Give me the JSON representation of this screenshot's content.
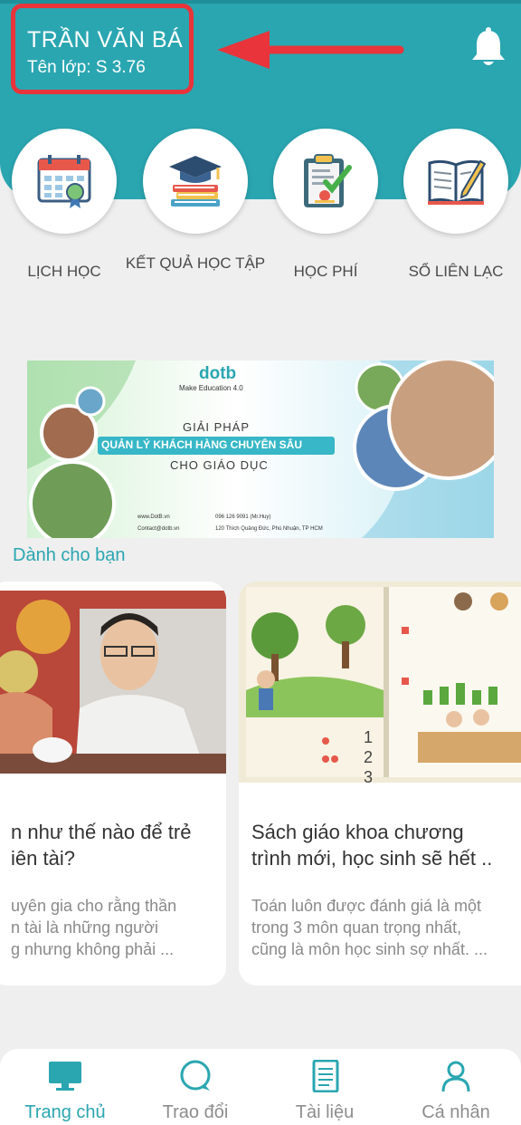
{
  "header": {
    "user_name": "TRẦN VĂN BÁ",
    "class_label": "Tên lớp: S 3.76",
    "accent_color": "#2aa6b1",
    "annotation_color": "#e8343a"
  },
  "menu": [
    {
      "label": "LỊCH HỌC",
      "icon": "calendar-icon"
    },
    {
      "label": "KẾT QUẢ HỌC TẬP",
      "icon": "graduation-books-icon"
    },
    {
      "label": "HỌC PHÍ",
      "icon": "clipboard-check-icon"
    },
    {
      "label": "SỔ LIÊN LẠC",
      "icon": "open-book-pen-icon"
    }
  ],
  "banner": {
    "brand": "dotb",
    "tagline": "Make Education 4.0",
    "line1": "GIẢI PHÁP",
    "line2": "QUẢN LÝ KHÁCH HÀNG CHUYÊN SÂU",
    "line3": "CHO GIÁO DỤC",
    "website": "www.DotB.vn",
    "email": "Contact@dotb.vn",
    "phone": "096 126 9091 (Mr.Huy)",
    "address": "120 Thích Quảng Đức, Phú Nhuận, TP HCM"
  },
  "section_title": "Dành cho bạn",
  "articles": [
    {
      "title_l1": "n như thế nào để trẻ",
      "title_l2": "iên tài?",
      "desc_l1": "uyên gia cho rằng thần",
      "desc_l2": "n tài là những người",
      "desc_l3": "g nhưng không phải ..."
    },
    {
      "title_l1": "Sách giáo khoa chương",
      "title_l2": "trình mới, học sinh sẽ hết ..",
      "desc_l1": "Toán luôn được đánh giá là một",
      "desc_l2": "trong 3 môn quan trọng nhất,",
      "desc_l3": "cũng là môn học sinh sợ nhất. ..."
    }
  ],
  "nav": [
    {
      "label": "Trang chủ",
      "icon": "monitor-icon",
      "active": true
    },
    {
      "label": "Trao đổi",
      "icon": "chat-bubble-icon",
      "active": false
    },
    {
      "label": "Tài liệu",
      "icon": "document-icon",
      "active": false
    },
    {
      "label": "Cá nhân",
      "icon": "person-icon",
      "active": false
    }
  ]
}
